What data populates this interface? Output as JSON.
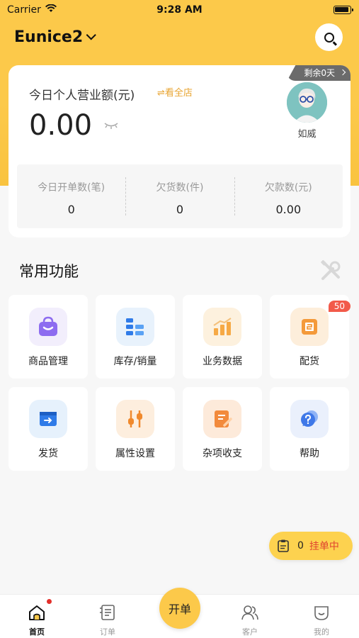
{
  "status": {
    "carrier": "Carrier",
    "time": "9:28 AM"
  },
  "header": {
    "store_name": "Eunice2"
  },
  "card": {
    "remaining": "剩余0天",
    "revenue_label": "今日个人营业额(元)",
    "view_all": "⇌看全店",
    "revenue_value": "0.00",
    "user_name": "如威",
    "stats": [
      {
        "label": "今日开单数(笔)",
        "value": "0"
      },
      {
        "label": "欠货数(件)",
        "value": "0"
      },
      {
        "label": "欠款数(元)",
        "value": "0.00"
      }
    ]
  },
  "functions": {
    "title": "常用功能",
    "items": [
      {
        "label": "商品管理",
        "icon": "bag-icon"
      },
      {
        "label": "库存/销量",
        "icon": "inventory-icon"
      },
      {
        "label": "业务数据",
        "icon": "bar-chart-icon"
      },
      {
        "label": "配货",
        "icon": "distribution-icon",
        "badge": "50"
      },
      {
        "label": "发货",
        "icon": "shipping-icon"
      },
      {
        "label": "属性设置",
        "icon": "sliders-icon"
      },
      {
        "label": "杂项收支",
        "icon": "notes-icon"
      },
      {
        "label": "帮助",
        "icon": "help-icon"
      }
    ]
  },
  "pending": {
    "count": "0",
    "label": "挂单中"
  },
  "tabbar": {
    "tabs": [
      {
        "label": "首页",
        "active": true
      },
      {
        "label": "订单"
      },
      {
        "label": "客户"
      },
      {
        "label": "我的"
      }
    ],
    "center_button": "开单"
  },
  "colors": {
    "accent": "#fcc94a",
    "badge": "#f25a4a",
    "pending_text": "#e0442f"
  }
}
